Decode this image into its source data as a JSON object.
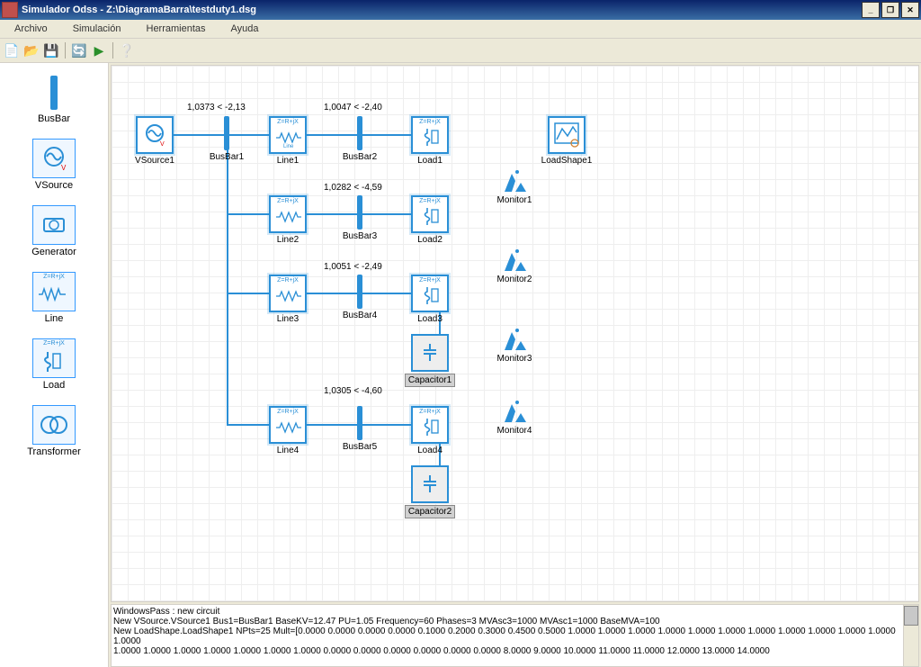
{
  "window": {
    "title": "Simulador Odss - Z:\\DiagramaBarra\\testduty1.dsg"
  },
  "menu": {
    "archivo": "Archivo",
    "simulacion": "Simulación",
    "herramientas": "Herramientas",
    "ayuda": "Ayuda"
  },
  "palette": {
    "busbar": "BusBar",
    "vsource": "VSource",
    "generator": "Generator",
    "line": "Line",
    "load": "Load",
    "transformer": "Transformer"
  },
  "labels": {
    "vsource1": "VSource1",
    "busbar1": "BusBar1",
    "line1": "Line1",
    "busbar2": "BusBar2",
    "load1": "Load1",
    "line2": "Line2",
    "busbar3": "BusBar3",
    "load2": "Load2",
    "line3": "Line3",
    "busbar4": "BusBar4",
    "load3": "Load3",
    "cap1": "Capacitor1",
    "line4": "Line4",
    "busbar5": "BusBar5",
    "load4": "Load4",
    "cap2": "Capacitor2",
    "loadshape1": "LoadShape1",
    "mon1": "Monitor1",
    "mon2": "Monitor2",
    "mon3": "Monitor3",
    "mon4": "Monitor4"
  },
  "voltages": {
    "b1": "1,0373 < -2,13",
    "b2": "1,0047 < -2,40",
    "b3": "1,0282 < -4,59",
    "b4": "1,0051 < -2,49",
    "b5": "1,0305 < -4,60"
  },
  "component_text": {
    "zlab": "Z=R+jX",
    "line": "Line",
    "load": "Load",
    "gen": "Generator",
    "cap": "Capacitor",
    "trans": "Transformer",
    "ls": "LoadShape"
  },
  "output": {
    "l1": "WindowsPass : new circuit",
    "l2": "New VSource.VSource1 Bus1=BusBar1 BaseKV=12.47 PU=1.05 Frequency=60 Phases=3 MVAsc3=1000 MVAsc1=1000 BaseMVA=100",
    "l3": "New LoadShape.LoadShape1 NPts=25 Mult=[0.0000 0.0000 0.0000 0.0000 0.1000 0.2000 0.3000 0.4500 0.5000 1.0000 1.0000 1.0000 1.0000 1.0000 1.0000 1.0000 1.0000 1.0000 1.0000 1.0000 1.0000",
    "l4": "1.0000 1.0000 1.0000 1.0000 1.0000 1.0000 1.0000 0.0000 0.0000 0.0000 0.0000 0.0000 0.0000 8.0000 9.0000 10.0000 11.0000 11.0000 12.0000 13.0000 14.0000"
  }
}
